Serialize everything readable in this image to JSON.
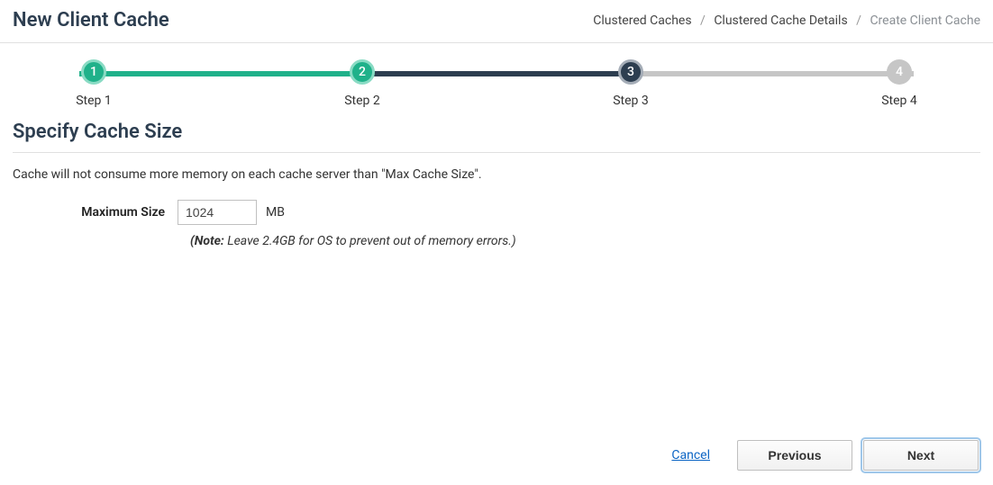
{
  "header": {
    "title": "New Client Cache",
    "breadcrumb": {
      "items": [
        {
          "label": "Clustered Caches"
        },
        {
          "label": "Clustered Cache Details"
        }
      ],
      "current": "Create Client Cache"
    }
  },
  "stepper": {
    "steps": [
      {
        "num": "1",
        "label": "Step 1",
        "state": "done"
      },
      {
        "num": "2",
        "label": "Step 2",
        "state": "done"
      },
      {
        "num": "3",
        "label": "Step 3",
        "state": "active"
      },
      {
        "num": "4",
        "label": "Step 4",
        "state": "pending"
      }
    ]
  },
  "section": {
    "title": "Specify Cache Size",
    "description": "Cache will not consume more memory on each cache server than \"Max Cache Size\"."
  },
  "form": {
    "max_size": {
      "label": "Maximum Size",
      "value": "1024",
      "unit": "MB",
      "note_prefix": "(Note:",
      "note_text": " Leave 2.4GB for OS to prevent out of memory errors.)"
    }
  },
  "footer": {
    "cancel": "Cancel",
    "previous": "Previous",
    "next": "Next"
  }
}
